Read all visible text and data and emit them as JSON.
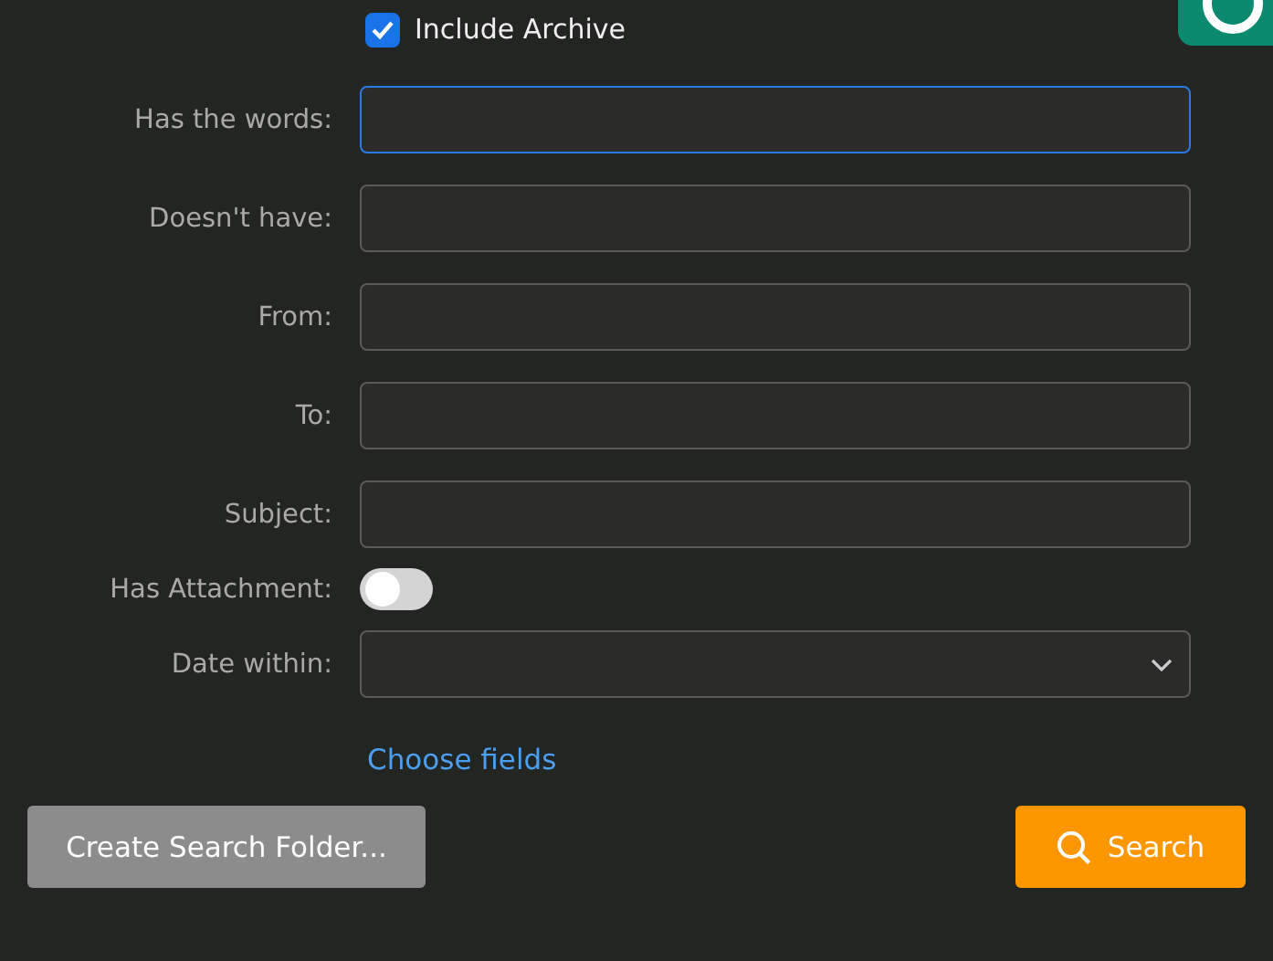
{
  "include_archive": {
    "label": "Include Archive",
    "checked": true
  },
  "fields": [
    {
      "kind": "text",
      "label": "Has the words:",
      "focused": true
    },
    {
      "kind": "text",
      "label": "Doesn't have:",
      "focused": false
    },
    {
      "kind": "text",
      "label": "From:",
      "focused": false
    },
    {
      "kind": "text",
      "label": "To:",
      "focused": false
    },
    {
      "kind": "text",
      "label": "Subject:",
      "focused": false
    },
    {
      "kind": "toggle",
      "label": "Has Attachment:",
      "on": false
    },
    {
      "kind": "select",
      "label": "Date within:",
      "focused": false
    }
  ],
  "choose_fields_link": "Choose fields",
  "buttons": {
    "create_folder": "Create Search Folder...",
    "search": "Search"
  }
}
